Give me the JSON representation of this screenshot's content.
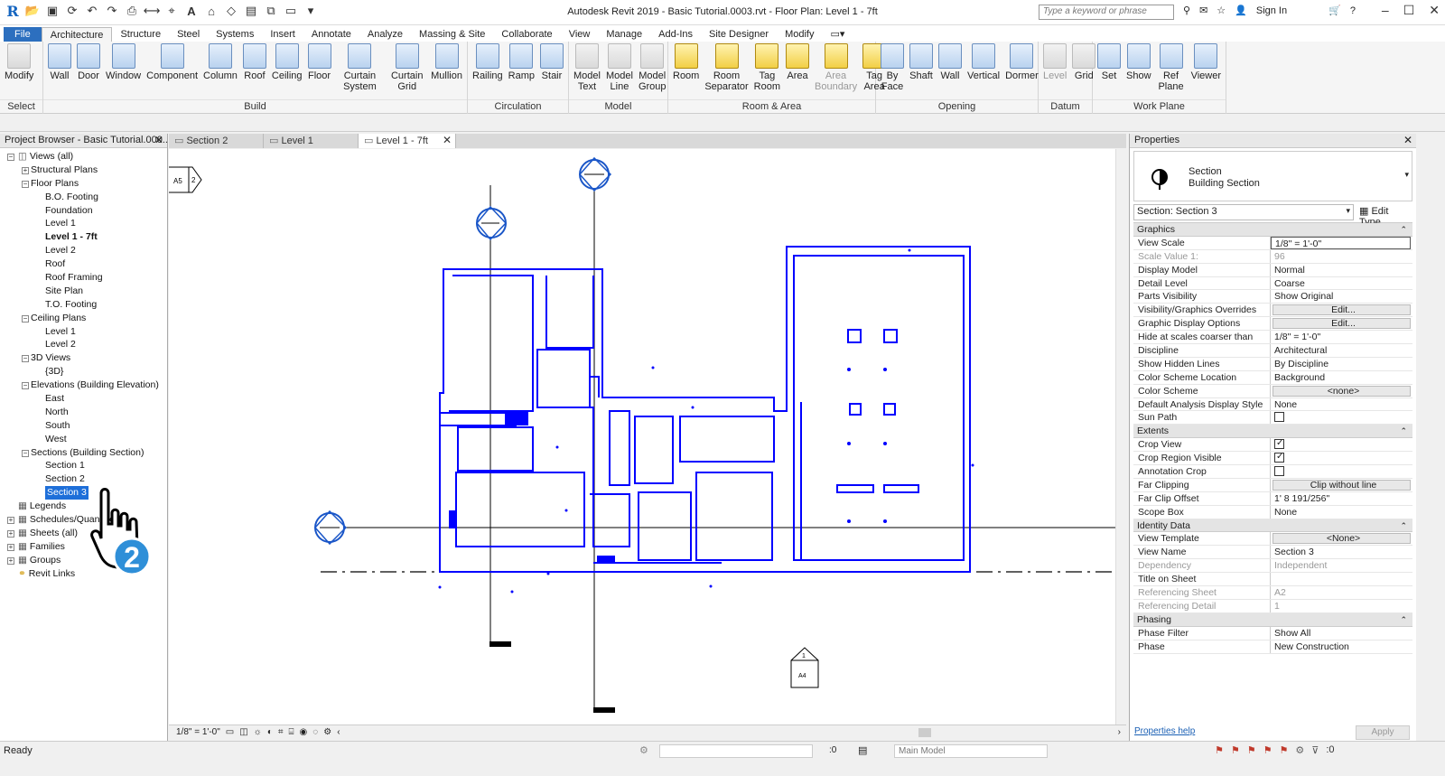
{
  "titlebar": {
    "title": "Autodesk Revit 2019 - Basic Tutorial.0003.rvt - Floor Plan: Level 1 - 7ft",
    "search_placeholder": "Type a keyword or phrase",
    "sign_in": "Sign In"
  },
  "ribbon_tabs": [
    "File",
    "Architecture",
    "Structure",
    "Steel",
    "Systems",
    "Insert",
    "Annotate",
    "Analyze",
    "Massing & Site",
    "Collaborate",
    "View",
    "Manage",
    "Add-Ins",
    "Site Designer",
    "Modify"
  ],
  "ribbon": {
    "select": {
      "label": "Select",
      "tools": [
        "Modify"
      ]
    },
    "build": {
      "label": "Build",
      "tools": [
        "Wall",
        "Door",
        "Window",
        "Component",
        "Column",
        "Roof",
        "Ceiling",
        "Floor",
        "Curtain System",
        "Curtain Grid",
        "Mullion"
      ]
    },
    "circulation": {
      "label": "Circulation",
      "tools": [
        "Railing",
        "Ramp",
        "Stair"
      ]
    },
    "model": {
      "label": "Model",
      "tools": [
        "Model Text",
        "Model Line",
        "Model Group"
      ]
    },
    "room_area": {
      "label": "Room & Area",
      "tools": [
        "Room",
        "Room Separator",
        "Tag Room",
        "Area",
        "Area Boundary",
        "Tag Area"
      ]
    },
    "opening": {
      "label": "Opening",
      "tools": [
        "By Face",
        "Shaft",
        "Wall",
        "Vertical",
        "Dormer"
      ]
    },
    "datum": {
      "label": "Datum",
      "tools": [
        "Level",
        "Grid"
      ]
    },
    "work_plane": {
      "label": "Work Plane",
      "tools": [
        "Set",
        "Show",
        "Ref Plane",
        "Viewer"
      ]
    }
  },
  "project_browser": {
    "title": "Project Browser - Basic Tutorial.000...",
    "tree": [
      {
        "label": "Views (all)",
        "level": 0,
        "exp": "-",
        "icon": "views-icon"
      },
      {
        "label": "Structural Plans",
        "level": 1,
        "exp": "+"
      },
      {
        "label": "Floor Plans",
        "level": 1,
        "exp": "-"
      },
      {
        "label": "B.O. Footing",
        "level": 2
      },
      {
        "label": "Foundation",
        "level": 2
      },
      {
        "label": "Level 1",
        "level": 2
      },
      {
        "label": "Level 1 - 7ft",
        "level": 2,
        "bold": true
      },
      {
        "label": "Level 2",
        "level": 2
      },
      {
        "label": "Roof",
        "level": 2
      },
      {
        "label": "Roof Framing",
        "level": 2
      },
      {
        "label": "Site Plan",
        "level": 2
      },
      {
        "label": "T.O. Footing",
        "level": 2
      },
      {
        "label": "Ceiling Plans",
        "level": 1,
        "exp": "-"
      },
      {
        "label": "Level 1",
        "level": 2
      },
      {
        "label": "Level 2",
        "level": 2
      },
      {
        "label": "3D Views",
        "level": 1,
        "exp": "-"
      },
      {
        "label": "{3D}",
        "level": 2
      },
      {
        "label": "Elevations (Building Elevation)",
        "level": 1,
        "exp": "-"
      },
      {
        "label": "East",
        "level": 2
      },
      {
        "label": "North",
        "level": 2
      },
      {
        "label": "South",
        "level": 2
      },
      {
        "label": "West",
        "level": 2
      },
      {
        "label": "Sections (Building Section)",
        "level": 1,
        "exp": "-"
      },
      {
        "label": "Section 1",
        "level": 2
      },
      {
        "label": "Section 2",
        "level": 2
      },
      {
        "label": "Section 3",
        "level": 2,
        "selected": true
      },
      {
        "label": "Legends",
        "level": 0,
        "icon": "legend-icon"
      },
      {
        "label": "Schedules/Quantities",
        "level": 0,
        "exp": "+",
        "icon": "schedule-icon"
      },
      {
        "label": "Sheets (all)",
        "level": 0,
        "exp": "+",
        "icon": "sheet-icon"
      },
      {
        "label": "Families",
        "level": 0,
        "exp": "+",
        "icon": "family-icon"
      },
      {
        "label": "Groups",
        "level": 0,
        "exp": "+",
        "icon": "group-icon"
      },
      {
        "label": "Revit Links",
        "level": 0,
        "icon": "link-icon"
      }
    ]
  },
  "view_tabs": [
    {
      "label": "Section 2",
      "active": false
    },
    {
      "label": "Level 1",
      "active": false
    },
    {
      "label": "Level 1 - 7ft",
      "active": true
    }
  ],
  "canvas": {
    "elev_marker_ref": "A5",
    "elev_marker_num": "2",
    "section_tag_num": "1",
    "section_tag_sheet": "A4"
  },
  "view_control": {
    "scale": "1/8\" = 1'-0\""
  },
  "properties": {
    "title": "Properties",
    "family": "Section",
    "type": "Building Section",
    "instance": "Section: Section 3",
    "edit_type": "Edit Type",
    "groups": [
      {
        "name": "Graphics",
        "rows": [
          {
            "name": "View Scale",
            "value": "1/8\" = 1'-0\"",
            "style": "boxed"
          },
          {
            "name": "Scale Value    1:",
            "value": "96",
            "dim": true
          },
          {
            "name": "Display Model",
            "value": "Normal"
          },
          {
            "name": "Detail Level",
            "value": "Coarse"
          },
          {
            "name": "Parts Visibility",
            "value": "Show Original"
          },
          {
            "name": "Visibility/Graphics Overrides",
            "value": "Edit...",
            "style": "btn"
          },
          {
            "name": "Graphic Display Options",
            "value": "Edit...",
            "style": "btn"
          },
          {
            "name": "Hide at scales coarser than",
            "value": "1/8\" = 1'-0\""
          },
          {
            "name": "Discipline",
            "value": "Architectural"
          },
          {
            "name": "Show Hidden Lines",
            "value": "By Discipline"
          },
          {
            "name": "Color Scheme Location",
            "value": "Background"
          },
          {
            "name": "Color Scheme",
            "value": "<none>",
            "style": "btn"
          },
          {
            "name": "Default Analysis Display Style",
            "value": "None"
          },
          {
            "name": "Sun Path",
            "value": "",
            "check": false
          }
        ]
      },
      {
        "name": "Extents",
        "rows": [
          {
            "name": "Crop View",
            "value": "",
            "check": true
          },
          {
            "name": "Crop Region Visible",
            "value": "",
            "check": true
          },
          {
            "name": "Annotation Crop",
            "value": "",
            "check": false
          },
          {
            "name": "Far Clipping",
            "value": "Clip without line",
            "style": "btn"
          },
          {
            "name": "Far Clip Offset",
            "value": "1'  8 191/256\""
          },
          {
            "name": "Scope Box",
            "value": "None"
          }
        ]
      },
      {
        "name": "Identity Data",
        "rows": [
          {
            "name": "View Template",
            "value": "<None>",
            "style": "btn"
          },
          {
            "name": "View Name",
            "value": "Section 3"
          },
          {
            "name": "Dependency",
            "value": "Independent",
            "dim": true
          },
          {
            "name": "Title on Sheet",
            "value": ""
          },
          {
            "name": "Referencing Sheet",
            "value": "A2",
            "dim": true
          },
          {
            "name": "Referencing Detail",
            "value": "1",
            "dim": true
          }
        ]
      },
      {
        "name": "Phasing",
        "rows": [
          {
            "name": "Phase Filter",
            "value": "Show All"
          },
          {
            "name": "Phase",
            "value": "New Construction"
          }
        ]
      }
    ],
    "help": "Properties help",
    "apply": "Apply"
  },
  "status": {
    "text": "Ready",
    "zero": ":0",
    "model": "Main Model",
    "filter_count": ":0"
  },
  "overlay": {
    "step": "2"
  },
  "colors": {
    "accent": "#2c6fbf",
    "model_line": "#0000ff",
    "selection": "#1e6fd9"
  }
}
